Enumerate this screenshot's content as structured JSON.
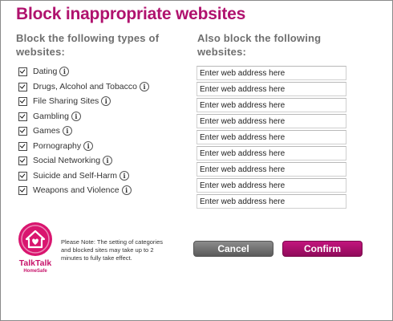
{
  "title": "Block inappropriate websites",
  "left_heading": "Block the following types of websites:",
  "right_heading": "Also block the following websites:",
  "categories": [
    {
      "label": "Dating",
      "checked": true
    },
    {
      "label": "Drugs, Alcohol and Tobacco",
      "checked": true
    },
    {
      "label": "File Sharing Sites",
      "checked": true
    },
    {
      "label": "Gambling",
      "checked": true
    },
    {
      "label": "Games",
      "checked": true
    },
    {
      "label": "Pornography",
      "checked": true
    },
    {
      "label": "Social Networking",
      "checked": true
    },
    {
      "label": "Suicide and Self-Harm",
      "checked": true
    },
    {
      "label": "Weapons and Violence",
      "checked": true
    }
  ],
  "info_glyph": "i",
  "url_fields": [
    {
      "value": "Enter web address here"
    },
    {
      "value": "Enter web address here"
    },
    {
      "value": "Enter web address here"
    },
    {
      "value": "Enter web address here"
    },
    {
      "value": "Enter web address here"
    },
    {
      "value": "Enter web address here"
    },
    {
      "value": "Enter web address here"
    },
    {
      "value": "Enter web address here"
    },
    {
      "value": "Enter web address here"
    }
  ],
  "logo": {
    "brand": "TalkTalk",
    "product": "HomeSafe",
    "icon": "house-heart-icon"
  },
  "note": "Please Note: The setting of categories and blocked sites may take up to 2 minutes to fully take effect.",
  "buttons": {
    "cancel": "Cancel",
    "confirm": "Confirm"
  },
  "colors": {
    "accent": "#b0126e",
    "cancel": "#6e6e6e",
    "confirm": "#a50f6a"
  }
}
